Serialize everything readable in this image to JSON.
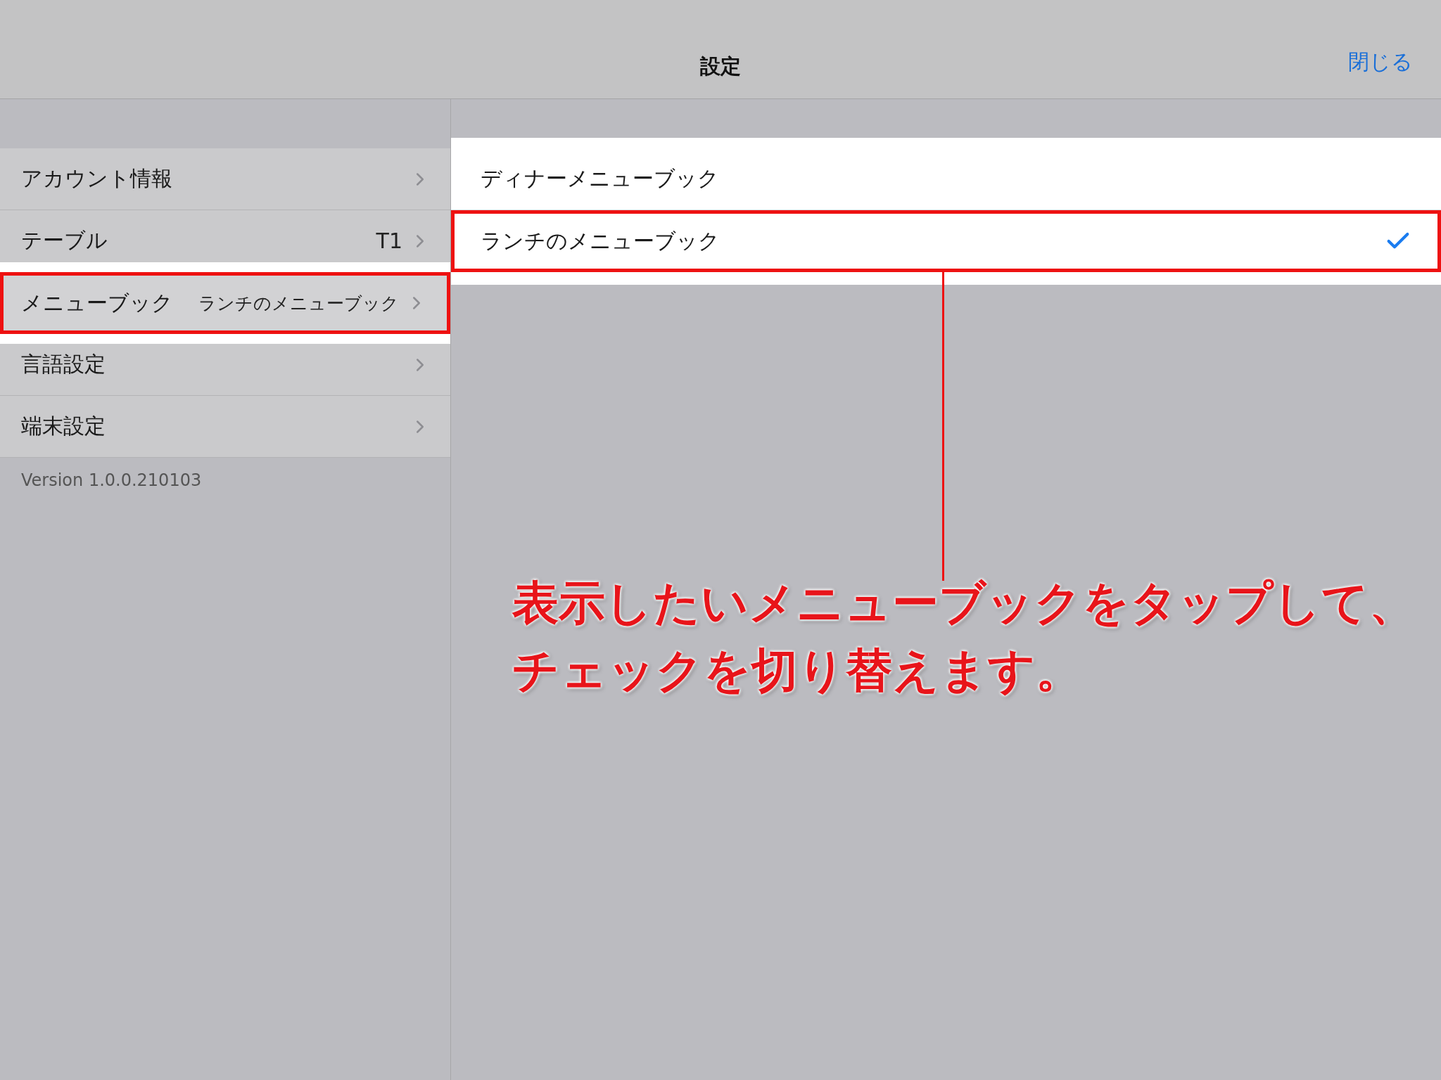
{
  "nav": {
    "title": "設定",
    "close": "閉じる"
  },
  "sidebar": {
    "items": [
      {
        "label": "アカウント情報",
        "selected": false
      },
      {
        "label": "テーブル",
        "value": "T1",
        "selected": false
      },
      {
        "label": "メニューブック",
        "value": "ランチのメニューブック",
        "selected": true
      },
      {
        "label": "言語設定",
        "selected": false
      },
      {
        "label": "端末設定",
        "selected": false
      }
    ],
    "version": "Version 1.0.0.210103"
  },
  "menubooks": [
    {
      "label": "ディナーメニューブック",
      "selected": false
    },
    {
      "label": "ランチのメニューブック",
      "selected": true
    }
  ],
  "annotation": "表示したいメニューブックをタップして、チェックを切り替えます。"
}
